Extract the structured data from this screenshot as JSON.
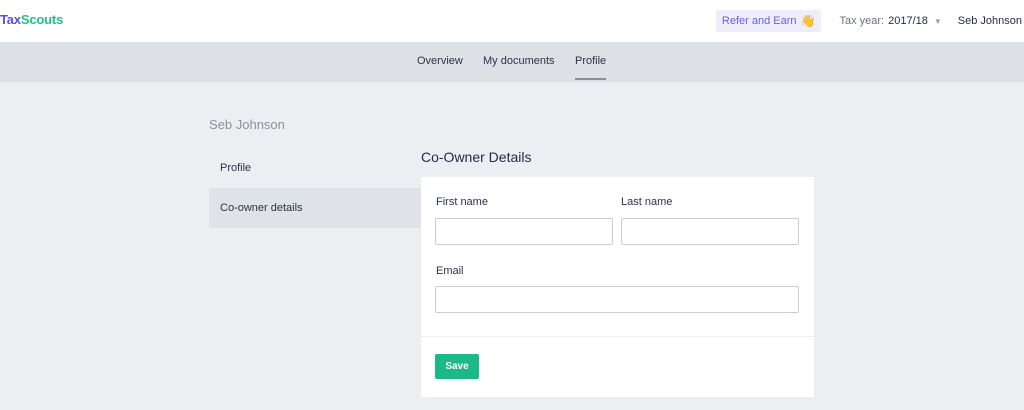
{
  "brand": {
    "part1": "Tax",
    "part2": "Scouts"
  },
  "header": {
    "refer_label": "Refer and Earn",
    "refer_icon": "waving-hand-icon",
    "tax_year_label": "Tax year:",
    "tax_year_value": "2017/18",
    "user_name": "Seb Johnson"
  },
  "nav": {
    "tabs": [
      {
        "label": "Overview"
      },
      {
        "label": "My documents"
      },
      {
        "label": "Profile",
        "active": true
      }
    ]
  },
  "sidebar": {
    "owner_name": "Seb Johnson",
    "items": [
      {
        "label": "Profile"
      },
      {
        "label": "Co-owner details",
        "active": true
      }
    ]
  },
  "form": {
    "title": "Co-Owner Details",
    "first_name_label": "First name",
    "first_name_value": "",
    "last_name_label": "Last name",
    "last_name_value": "",
    "email_label": "Email",
    "email_value": "",
    "save_label": "Save"
  },
  "colors": {
    "brand_purple": "#5b4fd6",
    "brand_green": "#22c08a",
    "save_button": "#1db887"
  }
}
